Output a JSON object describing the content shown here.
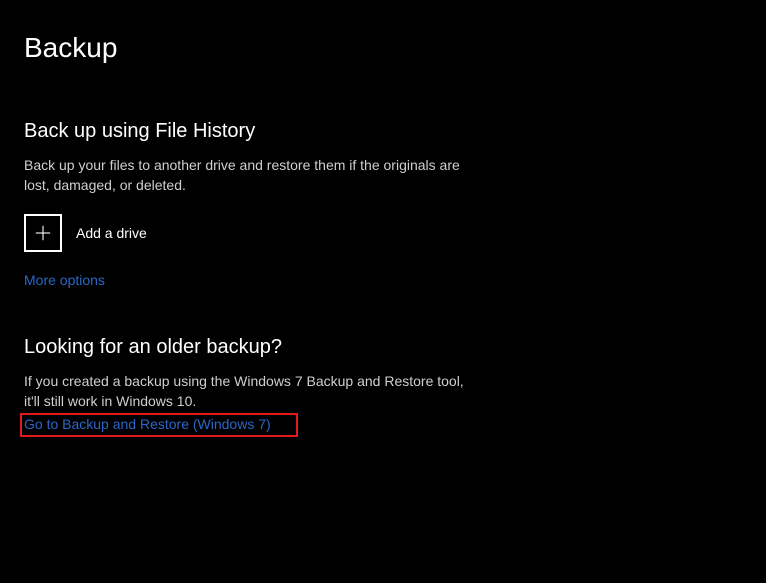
{
  "page": {
    "title": "Backup"
  },
  "fileHistory": {
    "heading": "Back up using File History",
    "description": "Back up your files to another drive and restore them if the originals are lost, damaged, or deleted.",
    "addDriveLabel": "Add a drive",
    "moreOptionsLabel": "More options"
  },
  "olderBackup": {
    "heading": "Looking for an older backup?",
    "description": "If you created a backup using the Windows 7 Backup and Restore tool, it'll still work in Windows 10.",
    "linkLabel": "Go to Backup and Restore (Windows 7)"
  },
  "colors": {
    "link": "#2a66c8",
    "highlight": "#e11b1b"
  }
}
